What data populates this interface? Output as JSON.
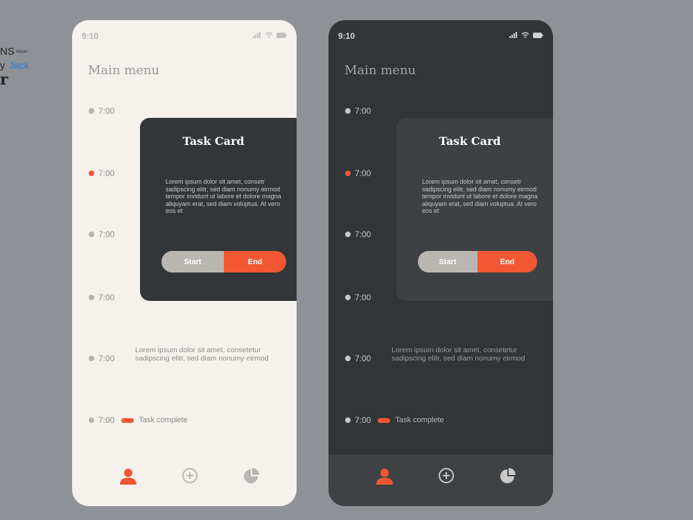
{
  "brand": {
    "line1": "NS",
    "line1_sub": "Adsan",
    "line2_prefix": "y",
    "author": "Jack",
    "line3": "r"
  },
  "phones": {
    "light": {
      "status": {
        "time": "9:10"
      },
      "title": "Main menu",
      "timeline": [
        {
          "time": "7:00",
          "active": false
        },
        {
          "time": "7:00",
          "active": true
        },
        {
          "time": "7:00",
          "active": false
        },
        {
          "time": "7:00",
          "active": false
        },
        {
          "time": "7:00",
          "active": false
        },
        {
          "time": "7:00",
          "active": false
        }
      ],
      "timeline_note": "Lorem ipsum dolor sit amet, consetetur sadipscing elitr, sed diam nonumy eirmod",
      "complete_label": "Task complete",
      "card": {
        "title": "Task Card",
        "body": "Lorem ipsum dolor sit amet, consetr sadipscing elitr, sed diam nonumy eirmod tempor invidunt ut labore et dolore magna aliquyam erat, sed diam voluptua. At vero eos et",
        "start_label": "Start",
        "end_label": "End"
      },
      "nav": [
        "user-icon",
        "add-circle-icon",
        "pie-chart-icon"
      ]
    },
    "dark": {
      "status": {
        "time": "9:10"
      },
      "title": "Main menu",
      "timeline": [
        {
          "time": "7:00",
          "active": false
        },
        {
          "time": "7:00",
          "active": true
        },
        {
          "time": "7:00",
          "active": false
        },
        {
          "time": "7:00",
          "active": false
        },
        {
          "time": "7:00",
          "active": false
        },
        {
          "time": "7:00",
          "active": false
        }
      ],
      "timeline_note": "Lorem ipsum dolor sit amet, consetetur sadipscing elitr, sed diam nonumy eirmod",
      "complete_label": "Task complete",
      "card": {
        "title": "Task Card",
        "body": "Lorem ipsum dolor sit amet, consetr sadipscing elitr, sed diam nonumy eirmod tempor invidunt ut labore et dolore magna aliquyam erat, sed diam voluptua. At vero eos et",
        "start_label": "Start",
        "end_label": "End"
      },
      "nav": [
        "user-icon",
        "add-circle-icon",
        "pie-chart-icon"
      ]
    }
  },
  "colors": {
    "accent": "#f25733",
    "page_bg": "#8e9196",
    "light_bg": "#f5f1ed",
    "dark_bg": "#323538",
    "card_dark": "#333639",
    "start_button": "#bab6b2"
  }
}
